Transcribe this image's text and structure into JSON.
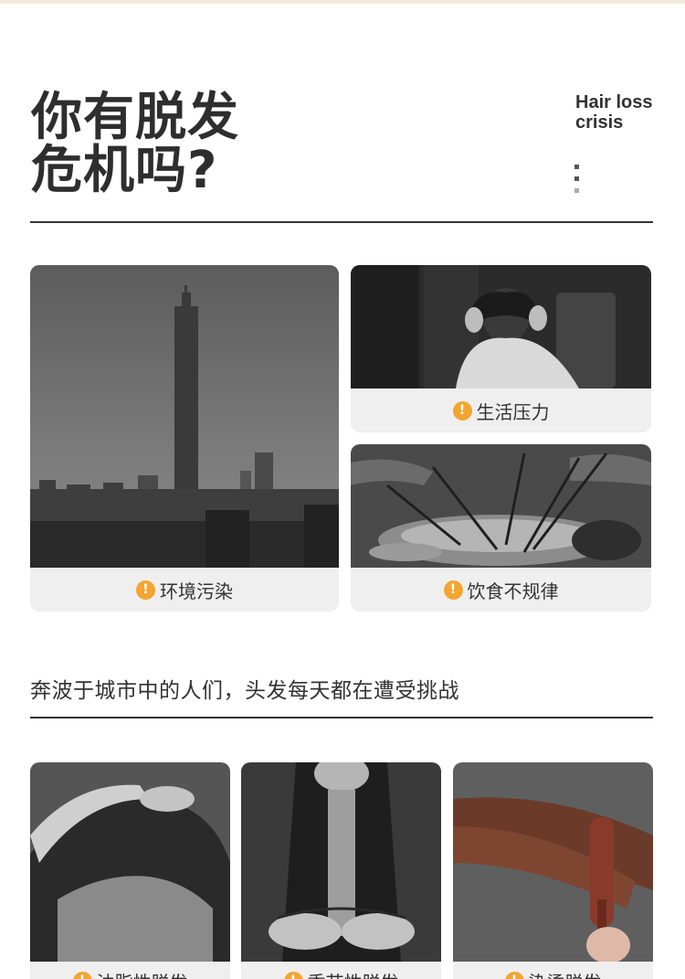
{
  "headline": {
    "line1": "你有脱发",
    "line2": "危机吗?"
  },
  "en_label": {
    "line1": "Hair loss",
    "line2": "crisis"
  },
  "cards_top": [
    {
      "label": "环境污染",
      "icon": "warning-icon"
    },
    {
      "label": "生活压力",
      "icon": "warning-icon"
    },
    {
      "label": "饮食不规律",
      "icon": "warning-icon"
    }
  ],
  "subtitle": "奔波于城市中的人们，头发每天都在遭受挑战",
  "cards_bottom": [
    {
      "label": "油脂性脱发",
      "icon": "warning-icon"
    },
    {
      "label": "季节性脱发",
      "icon": "warning-icon"
    },
    {
      "label": "染烫脱发",
      "icon": "warning-icon"
    }
  ],
  "colors": {
    "accent": "#f2a531",
    "text": "#2f2f2f",
    "card_bg": "#efefef"
  }
}
